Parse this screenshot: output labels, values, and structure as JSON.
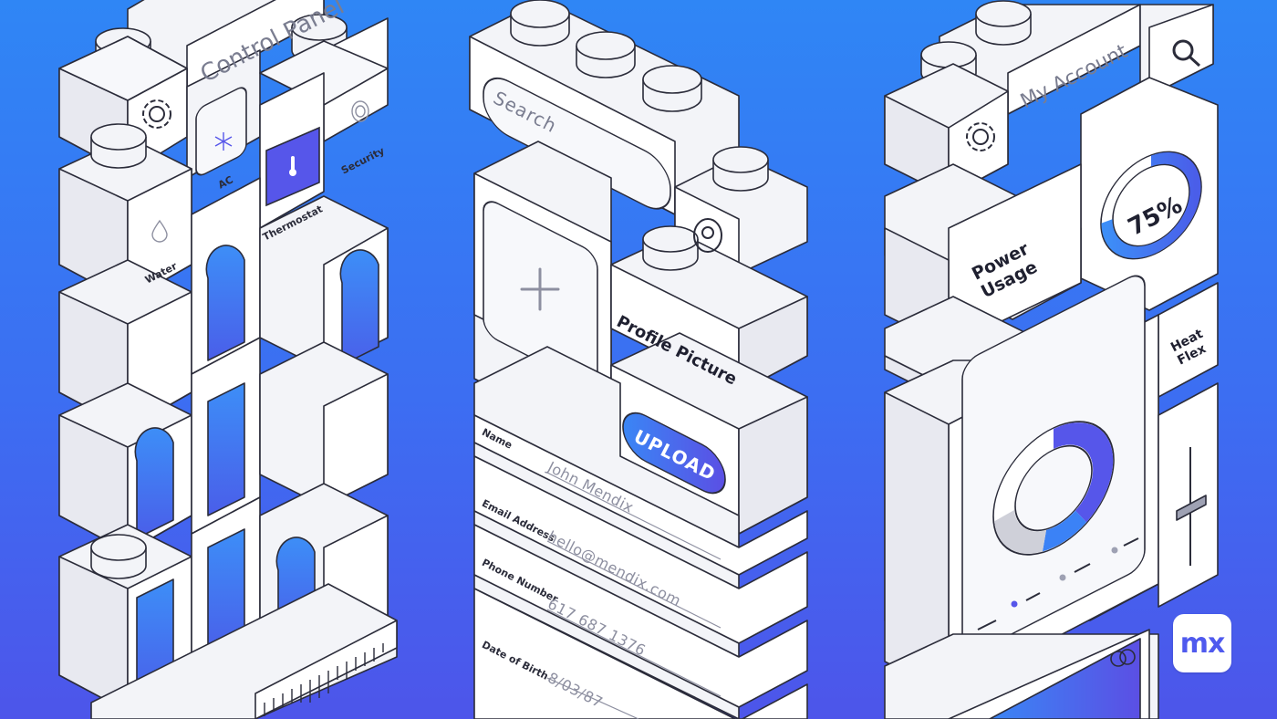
{
  "colors": {
    "background_top": "#2f86f5",
    "background_bottom": "#4d55ea",
    "brick_face": "#f3f4f8",
    "outline": "#2b2c3a",
    "accent_blue": "#3b82f6",
    "accent_violet": "#5656ea"
  },
  "left_tower": {
    "control_panel_label": "Control Panel",
    "settings_icon": "gear-icon",
    "tiles": [
      {
        "label": "AC",
        "icon": "snowflake-icon",
        "active": false
      },
      {
        "label": "Security",
        "icon": "target-icon",
        "active": false
      },
      {
        "label": "Water",
        "icon": "droplet-icon",
        "active": false
      },
      {
        "label": "Thermostat",
        "icon": "thermometer-icon",
        "active": true
      }
    ]
  },
  "middle_tower": {
    "search_placeholder": "Search",
    "add_icon": "plus-icon",
    "avatar_icon": "user-circle-icon",
    "profile_picture_label": "Profile Picture",
    "upload_label": "UPLOAD",
    "form": [
      {
        "label": "Name",
        "value": "John Mendix"
      },
      {
        "label": "Email Address",
        "value": "hello@mendix.com"
      },
      {
        "label": "Phone Number",
        "value": "617 687 1376"
      },
      {
        "label": "Date of Birth",
        "value": "8/03/87"
      }
    ]
  },
  "right_tower": {
    "account_label": "My Account",
    "search_icon": "search-icon",
    "settings_icon": "gear-icon",
    "power_usage_label": "Power Usage",
    "gauge_value": "75%",
    "gauge_fraction": 0.75,
    "heat_flex_label": "Heat Flex"
  },
  "brand": {
    "logo_text": "mx"
  }
}
